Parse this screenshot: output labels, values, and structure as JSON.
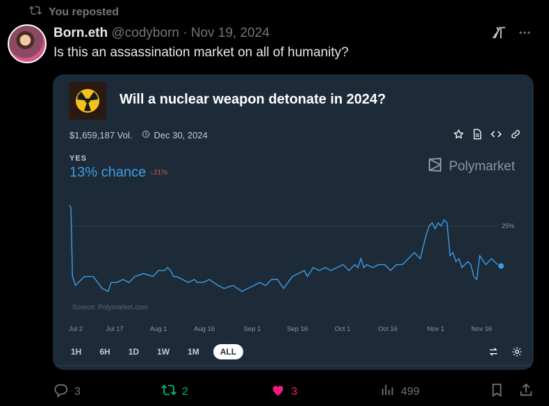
{
  "repost": {
    "text": "You reposted"
  },
  "author": {
    "name": "Born.eth",
    "handle": "@codyborn",
    "date": "Nov 19, 2024"
  },
  "tweet": {
    "text": "Is this an assassination market on all of humanity?"
  },
  "card": {
    "title": "Will a nuclear weapon detonate in 2024?",
    "volume": "$1,659,187 Vol.",
    "end_date": "Dec 30, 2024",
    "outcome_label": "YES",
    "chance": "13% chance",
    "change": "↓21%",
    "brand": "Polymarket",
    "watermark": "Source: Polymarket.com",
    "time_buttons": [
      "1H",
      "6H",
      "1D",
      "1W",
      "1M",
      "ALL"
    ],
    "active_time_button": "ALL"
  },
  "chart_data": {
    "type": "line",
    "x_ticks": [
      "Jul 2",
      "Jul 17",
      "Aug 1",
      "Aug 16",
      "Sep 1",
      "Sep 16",
      "Oct 1",
      "Oct 16",
      "Nov 1",
      "Nov 16"
    ],
    "y_ticks": [
      "25%"
    ],
    "series": [
      {
        "color": "#3d9ee3",
        "x": [
          0,
          0.5,
          1,
          2,
          3,
          5,
          8,
          11,
          13,
          14,
          16,
          18,
          20,
          22,
          25,
          28,
          30,
          32,
          33,
          34,
          35,
          36,
          38,
          40,
          42,
          43,
          45,
          47,
          50,
          52,
          55,
          58,
          60,
          62,
          64,
          66,
          68,
          70,
          72,
          75,
          77,
          79,
          80,
          82,
          84,
          86,
          88,
          90,
          92,
          94,
          96,
          97,
          98,
          99,
          100,
          102,
          104,
          106,
          108,
          110,
          112,
          114,
          116,
          118,
          120,
          121,
          122,
          123,
          124,
          125,
          126,
          127,
          128,
          129,
          130,
          131,
          132,
          133,
          134,
          135,
          136,
          137,
          138,
          140,
          141,
          142,
          143,
          144
        ],
        "y": [
          32,
          31,
          8,
          5,
          6,
          8,
          8,
          4,
          3,
          6,
          6,
          7,
          6,
          8,
          9,
          8,
          10,
          10,
          11,
          10,
          8,
          8,
          7,
          6,
          7,
          6,
          6,
          7,
          5,
          4,
          5,
          3,
          4,
          5,
          6,
          5,
          7,
          7,
          4,
          8,
          9,
          10,
          8,
          11,
          10,
          11,
          10,
          11,
          12,
          10,
          12,
          11,
          14,
          11,
          12,
          11,
          12,
          12,
          10,
          12,
          12,
          14,
          16,
          14,
          22,
          25,
          26,
          24,
          26,
          25,
          27,
          26,
          15,
          16,
          13,
          14,
          11,
          12,
          13,
          12,
          8,
          7,
          15,
          12,
          13,
          14,
          13,
          12
        ]
      }
    ],
    "ylim": [
      0,
      35
    ],
    "current_value": 13
  }
}
